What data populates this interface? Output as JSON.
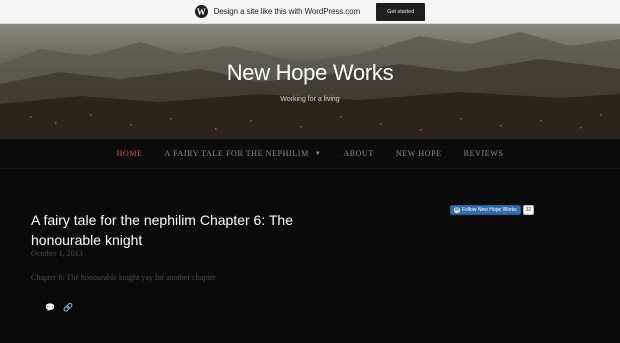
{
  "wp_bar": {
    "logo_glyph": "W",
    "text": "Design a site like this with WordPress.com",
    "button_label": "Get started"
  },
  "header": {
    "title": "New Hope Works",
    "description": "Working for a living"
  },
  "nav": {
    "items": [
      {
        "label": "HOME",
        "active": true
      },
      {
        "label": "A FAIRY TALE FOR THE NEPHILIM",
        "has_dropdown": true,
        "dropdown_icon": "▼"
      },
      {
        "label": "ABOUT"
      },
      {
        "label": "NEW HOPE"
      },
      {
        "label": "REVIEWS"
      }
    ]
  },
  "post": {
    "title": "A fairy tale for the nephilim Chapter 6: The honourable knight",
    "date": "October 1, 2013",
    "excerpt": "Chapter 6: The honourable knight yay for another chapter",
    "comment_icon": "💬",
    "link_icon": "🔗"
  },
  "follow_widget": {
    "logo_glyph": "W",
    "label": "Follow New Hope Works",
    "count": "32"
  },
  "colors": {
    "nav_active": "#d6544f",
    "follow_blue": "#2f6fb1",
    "background": "#0a0a0a"
  }
}
